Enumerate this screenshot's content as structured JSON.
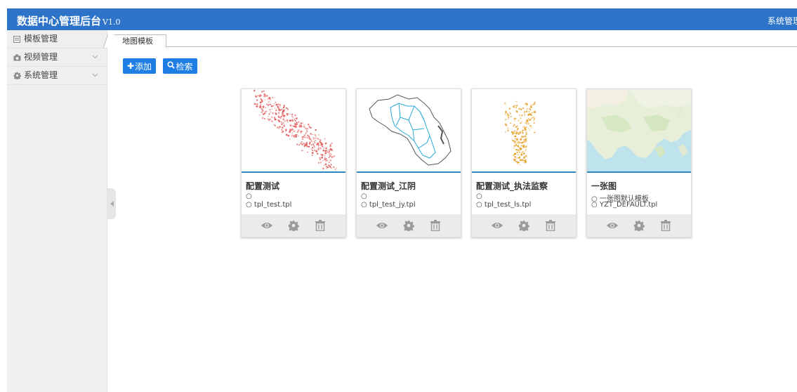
{
  "header": {
    "app_title": "数据中心管理后台",
    "app_version": "V1.0",
    "right_text": "系统管理"
  },
  "sidebar": {
    "items": [
      {
        "label": "模板管理",
        "icon": "template-icon",
        "expandable": false
      },
      {
        "label": "视频管理",
        "icon": "camera-icon",
        "expandable": true
      },
      {
        "label": "系统管理",
        "icon": "gear-icon",
        "expandable": true
      }
    ]
  },
  "tabs": [
    {
      "label": "地图模板",
      "active": true
    }
  ],
  "toolbar": {
    "add_label": "添加",
    "search_label": "检索"
  },
  "cards": [
    {
      "title": "配置测试",
      "description": "",
      "file": "tpl_test.tpl",
      "thumbnail": "red-point-density-map"
    },
    {
      "title": "配置测试_江阴",
      "description": "",
      "file": "tpl_test_jy.tpl",
      "thumbnail": "district-boundary-map"
    },
    {
      "title": "配置测试_执法监察",
      "description": "",
      "file": "tpl_test_ls.tpl",
      "thumbnail": "orange-point-map"
    },
    {
      "title": "一张图",
      "description": "一张图默认模板",
      "file": "YZT_DEFAULT.tpl",
      "thumbnail": "base-map"
    }
  ],
  "colors": {
    "header_bg": "#2d73c8",
    "button_bg": "#1e7ee6",
    "card_rule": "#2e86c1"
  }
}
